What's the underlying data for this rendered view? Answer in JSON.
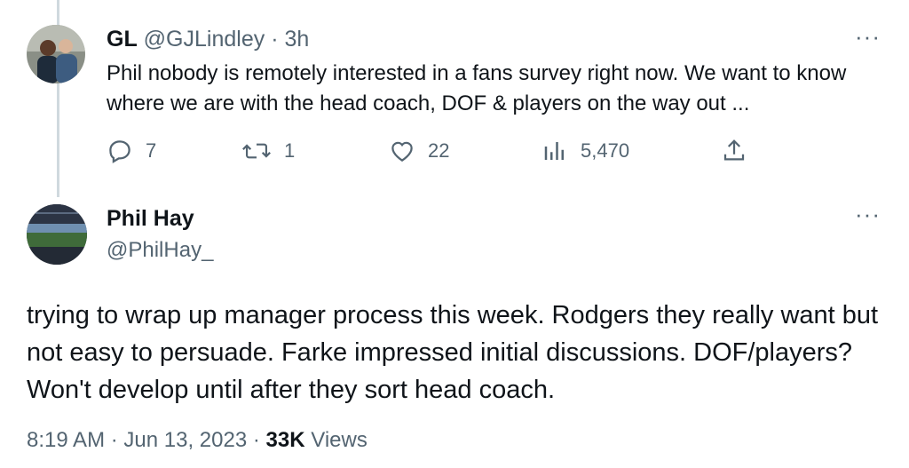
{
  "reply": {
    "name": "GL",
    "handle": "@GJLindley",
    "separator": "·",
    "time": "3h",
    "text": "Phil nobody is remotely interested in a fans survey right now. We want to know where we are with the head coach, DOF & players on the way out ...",
    "actions": {
      "replies": "7",
      "retweets": "1",
      "likes": "22",
      "views": "5,470"
    }
  },
  "more_label": "···",
  "tweet": {
    "name": "Phil Hay",
    "handle": "@PhilHay_",
    "text": "trying to wrap up manager process this week. Rodgers they really want but not easy to persuade. Farke impressed initial discussions. DOF/players? Won't develop until after they sort head coach.",
    "time": "8:19 AM",
    "date": "Jun 13, 2023",
    "views_count": "33K",
    "views_label": "Views",
    "separator": "·"
  },
  "colors": {
    "text": "#0f1419",
    "secondary": "#536471",
    "thread_line": "#cfd9de"
  }
}
